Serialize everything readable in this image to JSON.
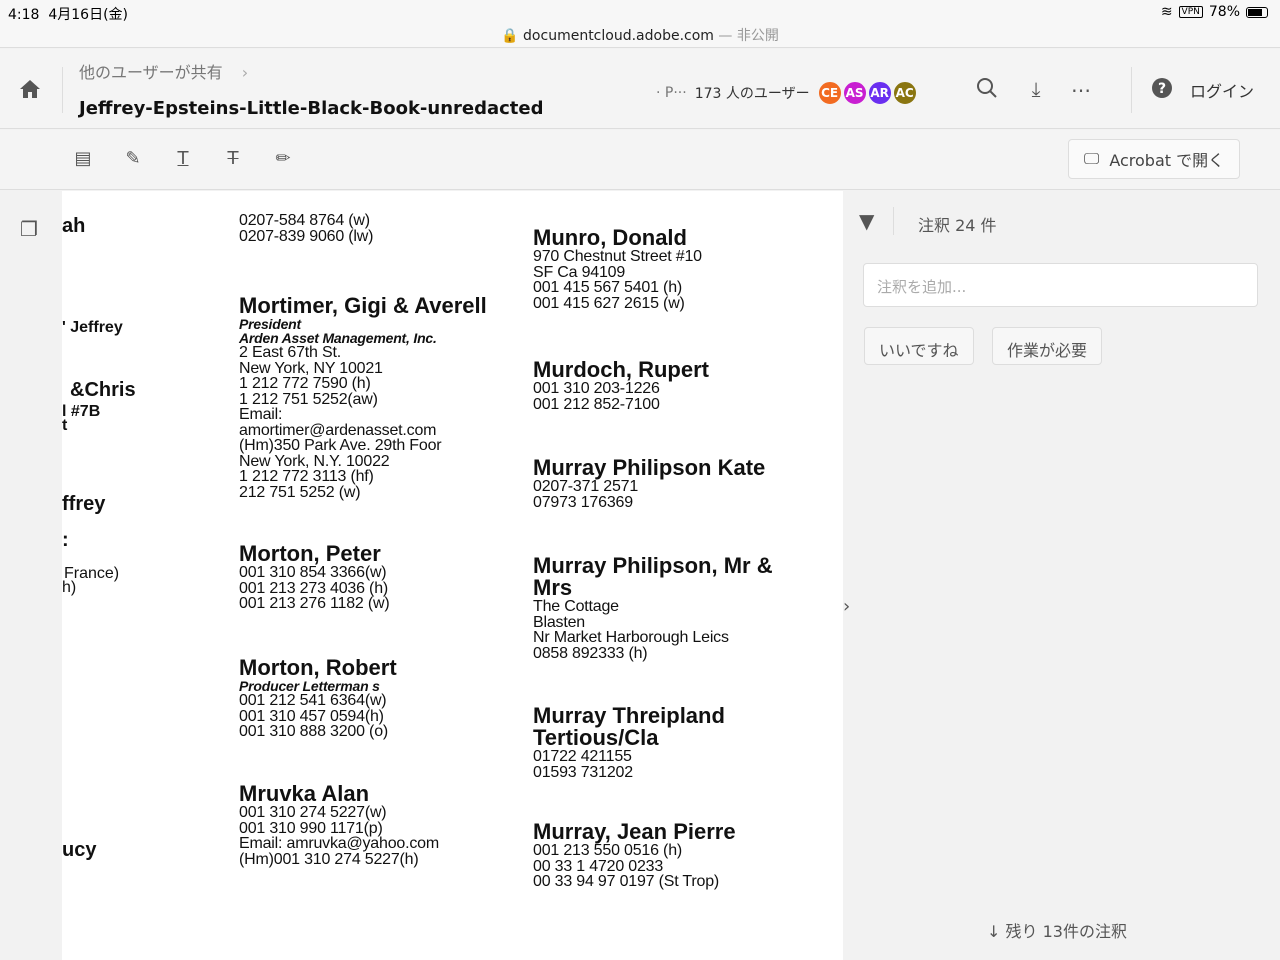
{
  "status_bar": {
    "time": "4:18",
    "date": "4月16日(金)",
    "url": "documentcloud.adobe.com",
    "url_suffix": " — 非公開",
    "vpn": "VPN",
    "battery": "78%"
  },
  "header": {
    "breadcrumb": "他のユーザーが共有",
    "title": "Jeffrey-Epsteins-Little-Black-Book-unredacted",
    "users_prefix": "· P···",
    "users_count": "173 人のユーザー",
    "avatars": [
      {
        "initials": "CE",
        "color": "#f26b21"
      },
      {
        "initials": "AS",
        "color": "#c81fd1"
      },
      {
        "initials": "AR",
        "color": "#6a2ff0"
      },
      {
        "initials": "AC",
        "color": "#8a7510"
      }
    ],
    "login": "ログイン"
  },
  "toolbar": {
    "open_acrobat": "Acrobat で開く"
  },
  "document": {
    "left_fragments": [
      "ah",
      "' Jeffrey",
      "&Chris",
      "l #7B",
      "t",
      "ffrey",
      ":",
      "France)",
      "h)",
      "ucy"
    ],
    "col1": [
      {
        "name": "",
        "lines": [
          "0207-584 8764 (w)",
          "0207-839 9060 (lw)"
        ]
      },
      {
        "name": "Mortimer, Gigi & Averell",
        "italic": [
          "President",
          "Arden Asset Management, Inc."
        ],
        "lines": [
          "2 East 67th St.",
          "New York, NY 10021",
          "1 212 772 7590 (h)",
          "1 212 751 5252(aw)",
          "Email:",
          "amortimer@ardenasset.com",
          "(Hm)350 Park Ave. 29th Foor",
          "New York, N.Y. 10022",
          "1 212 772 3113 (hf)",
          "212 751 5252 (w)"
        ]
      },
      {
        "name": "Morton, Peter",
        "lines": [
          "001 310 854 3366(w)",
          "001 213 273 4036 (h)",
          "001 213 276 1182 (w)"
        ]
      },
      {
        "name": "Morton, Robert",
        "italic": [
          "Producer Letterman s"
        ],
        "lines": [
          "001 212 541 6364(w)",
          "001 310 457 0594(h)",
          "001 310 888 3200 (o)"
        ]
      },
      {
        "name": "Mruvka Alan",
        "lines": [
          "001 310 274 5227(w)",
          "001 310 990 1171(p)",
          "Email: amruvka@yahoo.com",
          "(Hm)001 310 274 5227(h)"
        ]
      }
    ],
    "col2": [
      {
        "name": "Munro, Donald",
        "lines": [
          "970 Chestnut Street   #10",
          "SF Ca 94109",
          "001 415 567 5401 (h)",
          "001 415 627 2615 (w)"
        ]
      },
      {
        "name": "Murdoch, Rupert",
        "lines": [
          "001 310 203-1226",
          "001 212 852-7100"
        ]
      },
      {
        "name": "Murray Philipson Kate",
        "lines": [
          "0207-371 2571",
          "07973 176369"
        ]
      },
      {
        "name": "Murray Philipson, Mr & Mrs",
        "lines": [
          "The Cottage",
          "Blasten",
          "Nr Market Harborough Leics",
          "0858 892333 (h)"
        ]
      },
      {
        "name": "Murray Threipland Tertious/Cla",
        "lines": [
          "01722 421155",
          "01593 731202"
        ]
      },
      {
        "name": "Murray, Jean Pierre",
        "lines": [
          "001 213 550 0516 (h)",
          "00 33 1 4720 0233",
          "00 33 94 97 0197 (St Trop)"
        ]
      }
    ]
  },
  "panel": {
    "comment_count": "注釈 24 件",
    "add_placeholder": "注釈を追加...",
    "chips": [
      "いいですね",
      "作業が必要"
    ],
    "remaining": "残り 13件の注釈"
  }
}
